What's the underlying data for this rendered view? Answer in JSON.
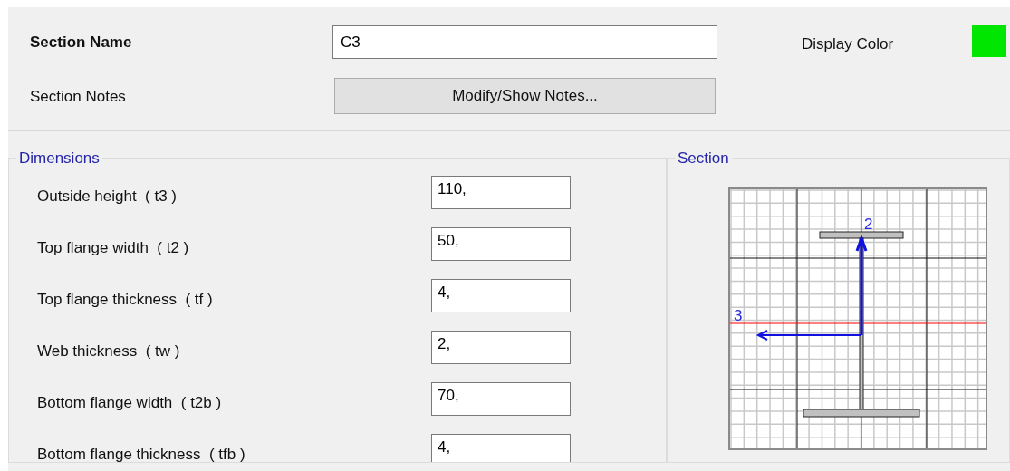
{
  "section_name": {
    "label": "Section Name",
    "value": "C3"
  },
  "display_color": {
    "label": "Display Color",
    "color": "#00e600"
  },
  "section_notes": {
    "label": "Section Notes",
    "button": "Modify/Show Notes..."
  },
  "dimensions": {
    "title": "Dimensions",
    "rows": [
      {
        "label": "Outside height  ( t3 )",
        "value": "110,"
      },
      {
        "label": "Top flange width  ( t2 )",
        "value": "50,"
      },
      {
        "label": "Top flange thickness  ( tf )",
        "value": "4,"
      },
      {
        "label": "Web thickness  ( tw )",
        "value": "2,"
      },
      {
        "label": "Bottom flange width  ( t2b )",
        "value": "70,"
      },
      {
        "label": "Bottom flange thickness  ( tfb )",
        "value": "4,"
      }
    ]
  },
  "section": {
    "title": "Section",
    "axis_vertical": "2",
    "axis_horizontal": "3"
  }
}
